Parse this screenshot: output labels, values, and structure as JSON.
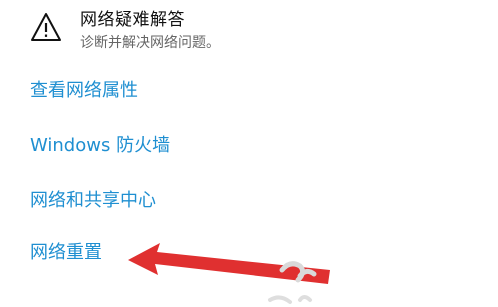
{
  "troubleshoot": {
    "title": "网络疑难解答",
    "subtitle": "诊断并解决网络问题。",
    "icon": "warning-icon"
  },
  "links": [
    {
      "label": "查看网络属性"
    },
    {
      "label": "Windows 防火墙"
    },
    {
      "label": "网络和共享中心"
    },
    {
      "label": "网络重置"
    }
  ],
  "annotation": {
    "arrow_color": "#e03030"
  }
}
